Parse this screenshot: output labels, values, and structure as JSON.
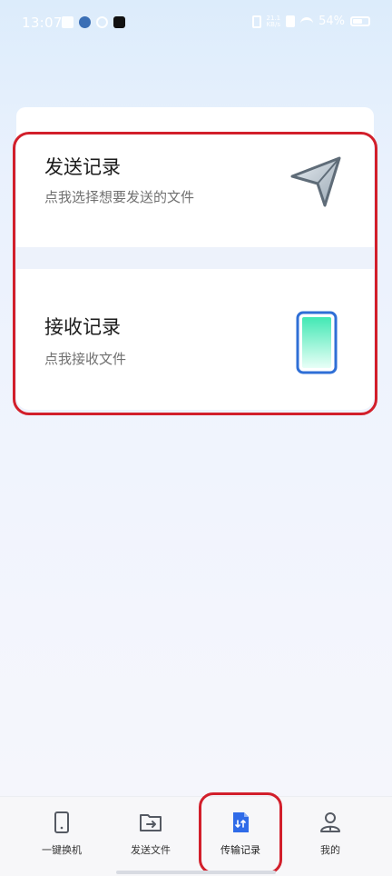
{
  "status_bar": {
    "time": "13:07",
    "net_speed": "21.1\nKB/s",
    "battery_percent": "54%"
  },
  "send_card": {
    "title": "发送记录",
    "subtitle": "点我选择想要发送的文件",
    "icon": "paper-plane-icon"
  },
  "receive_card": {
    "title": "接收记录",
    "subtitle": "点我接收文件",
    "icon": "phone-icon"
  },
  "bottom_nav": {
    "items": [
      {
        "label": "一键换机",
        "icon": "phone-outline-icon"
      },
      {
        "label": "发送文件",
        "icon": "folder-send-icon"
      },
      {
        "label": "传输记录",
        "icon": "transfer-file-icon",
        "active": true
      },
      {
        "label": "我的",
        "icon": "user-icon"
      }
    ]
  },
  "colors": {
    "accent": "#2f6be8",
    "highlight_border": "#d21f2b",
    "phone_gradient_top": "#42e8b4",
    "phone_gradient_bottom": "#e9fff7"
  }
}
